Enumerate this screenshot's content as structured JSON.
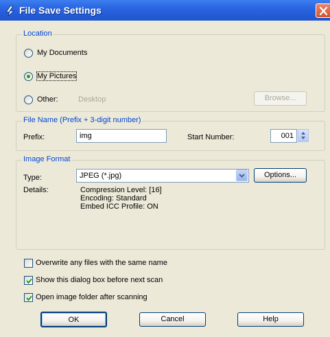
{
  "window": {
    "title": "File Save Settings"
  },
  "location": {
    "legend": "Location",
    "options": [
      {
        "label": "My Documents",
        "selected": false
      },
      {
        "label": "My Pictures",
        "selected": true
      },
      {
        "label": "Other:",
        "selected": false
      }
    ],
    "other_value": "Desktop",
    "browse_label": "Browse..."
  },
  "file_name": {
    "legend": "File Name (Prefix + 3-digit number)",
    "prefix_label": "Prefix:",
    "prefix_value": "img",
    "start_number_label": "Start Number:",
    "start_number_value": "001"
  },
  "image_format": {
    "legend": "Image Format",
    "type_label": "Type:",
    "type_value": "JPEG (*.jpg)",
    "options_label": "Options...",
    "details_label": "Details:",
    "details": [
      "Compression Level: [16]",
      "Encoding: Standard",
      "Embed ICC Profile: ON"
    ]
  },
  "checkboxes": [
    {
      "label": "Overwrite any files with the same name",
      "checked": false
    },
    {
      "label": "Show this dialog box before next scan",
      "checked": true
    },
    {
      "label": "Open image folder after scanning",
      "checked": true
    }
  ],
  "buttons": {
    "ok": "OK",
    "cancel": "Cancel",
    "help": "Help"
  },
  "icons": {
    "title_icon": "scanner-icon",
    "close_icon": "close-icon",
    "spin_icon": "spin-updown-icon",
    "dropdown_icon": "chevron-down-icon",
    "check_icon": "checkmark-icon"
  },
  "colors": {
    "titlebar": "#2a64e0",
    "legend_text": "#0046d5",
    "face": "#ece9d8",
    "check": "#21a121",
    "close": "#d2552f"
  }
}
